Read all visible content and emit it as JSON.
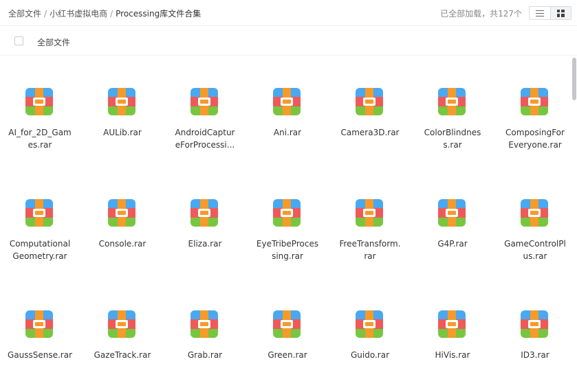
{
  "breadcrumb": {
    "root": "全部文件",
    "level1": "小红书虚拟电商",
    "current": "Processing库文件合集",
    "separator": "/"
  },
  "status": "已全部加载，共127个",
  "view": {
    "mode": "grid",
    "icons": [
      "list-icon",
      "grid-icon"
    ]
  },
  "header": {
    "select_all_label": "全部文件"
  },
  "files": [
    {
      "name_line1": "AI_for_2D_Gam",
      "name_line2": "es.rar"
    },
    {
      "name_line1": "AULib.rar",
      "name_line2": ""
    },
    {
      "name_line1": "AndroidCaptur",
      "name_line2": "eForProcessi..."
    },
    {
      "name_line1": "Ani.rar",
      "name_line2": ""
    },
    {
      "name_line1": "Camera3D.rar",
      "name_line2": ""
    },
    {
      "name_line1": "ColorBlindnes",
      "name_line2": "s.rar"
    },
    {
      "name_line1": "ComposingFor",
      "name_line2": "Everyone.rar"
    },
    {
      "name_line1": "Computational",
      "name_line2": "Geometry.rar"
    },
    {
      "name_line1": "Console.rar",
      "name_line2": ""
    },
    {
      "name_line1": "Eliza.rar",
      "name_line2": ""
    },
    {
      "name_line1": "EyeTribeProces",
      "name_line2": "sing.rar"
    },
    {
      "name_line1": "FreeTransform.",
      "name_line2": "rar"
    },
    {
      "name_line1": "G4P.rar",
      "name_line2": ""
    },
    {
      "name_line1": "GameControlPl",
      "name_line2": "us.rar"
    },
    {
      "name_line1": "GaussSense.rar",
      "name_line2": ""
    },
    {
      "name_line1": "GazeTrack.rar",
      "name_line2": ""
    },
    {
      "name_line1": "Grab.rar",
      "name_line2": ""
    },
    {
      "name_line1": "Green.rar",
      "name_line2": ""
    },
    {
      "name_line1": "Guido.rar",
      "name_line2": ""
    },
    {
      "name_line1": "HiVis.rar",
      "name_line2": ""
    },
    {
      "name_line1": "ID3.rar",
      "name_line2": ""
    }
  ],
  "file_icon": "rar-archive-icon",
  "colors": {
    "icon_blue": "#4aa8f0",
    "icon_red": "#ee5a5a",
    "icon_green": "#78c640",
    "icon_strap": "#f59b2b"
  }
}
